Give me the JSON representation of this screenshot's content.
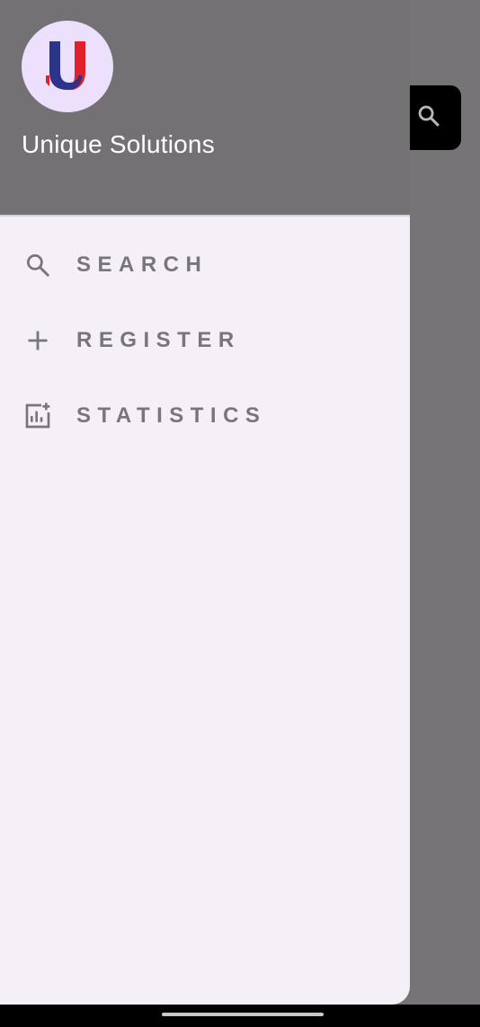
{
  "header": {
    "company_name": "Unique Solutions",
    "logo": "unique-solutions-u-logo"
  },
  "menu": {
    "items": [
      {
        "label": "SEARCH",
        "icon": "search-icon"
      },
      {
        "label": "REGISTER",
        "icon": "plus-icon"
      },
      {
        "label": "STATISTICS",
        "icon": "add-chart-icon"
      }
    ]
  },
  "background_screen": {
    "search_button_icon": "search-icon"
  },
  "colors": {
    "drawer_bg": "#f5f0f8",
    "header_bg": "#737174",
    "menu_text": "#79767a",
    "avatar_bg": "#ece0fd",
    "logo_blue": "#2d3388",
    "logo_red": "#e0202a"
  }
}
